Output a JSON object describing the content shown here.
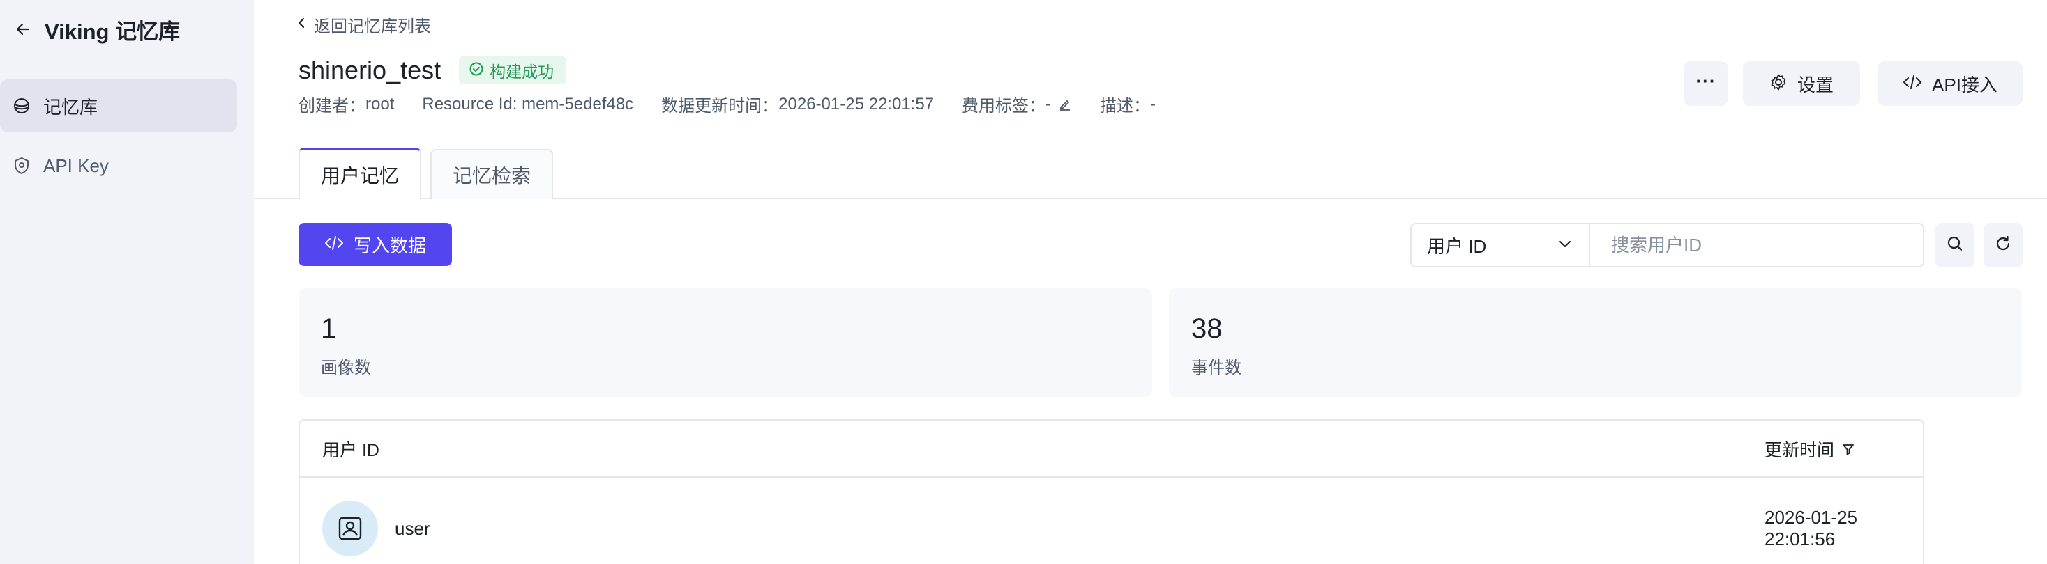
{
  "sidebar": {
    "title": "Viking 记忆库",
    "items": [
      {
        "label": "记忆库",
        "icon": "database-icon",
        "active": true
      },
      {
        "label": "API Key",
        "icon": "shield-icon",
        "active": false
      }
    ]
  },
  "breadcrumb": {
    "label": "返回记忆库列表"
  },
  "header": {
    "title": "shinerio_test",
    "status": "构建成功",
    "meta": {
      "creator_key": "创建者：",
      "creator": "root",
      "resource_key": "Resource Id: ",
      "resource_id": "mem-5edef48c",
      "updated_key": "数据更新时间：",
      "updated": "2026-01-25 22:01:57",
      "cost_tag_key": "费用标签：",
      "cost_tag": "-",
      "desc_key": "描述：",
      "desc": "-"
    },
    "actions": {
      "more_label": "···",
      "settings_label": "设置",
      "api_label": "API接入"
    }
  },
  "tabs": [
    {
      "label": "用户记忆",
      "active": true
    },
    {
      "label": "记忆检索",
      "active": false
    }
  ],
  "toolbar": {
    "write_label": "写入数据",
    "select_value": "用户 ID",
    "search_placeholder": "搜索用户ID"
  },
  "stats": [
    {
      "value": "1",
      "label": "画像数"
    },
    {
      "value": "38",
      "label": "事件数"
    }
  ],
  "table": {
    "columns": [
      "用户 ID",
      "更新时间"
    ],
    "rows": [
      {
        "user_id": "user",
        "updated": "2026-01-25 22:01:56"
      }
    ]
  },
  "colors": {
    "accent": "#5346f0",
    "success": "#1f9d55",
    "sidebar_bg": "#f2f3f8"
  }
}
